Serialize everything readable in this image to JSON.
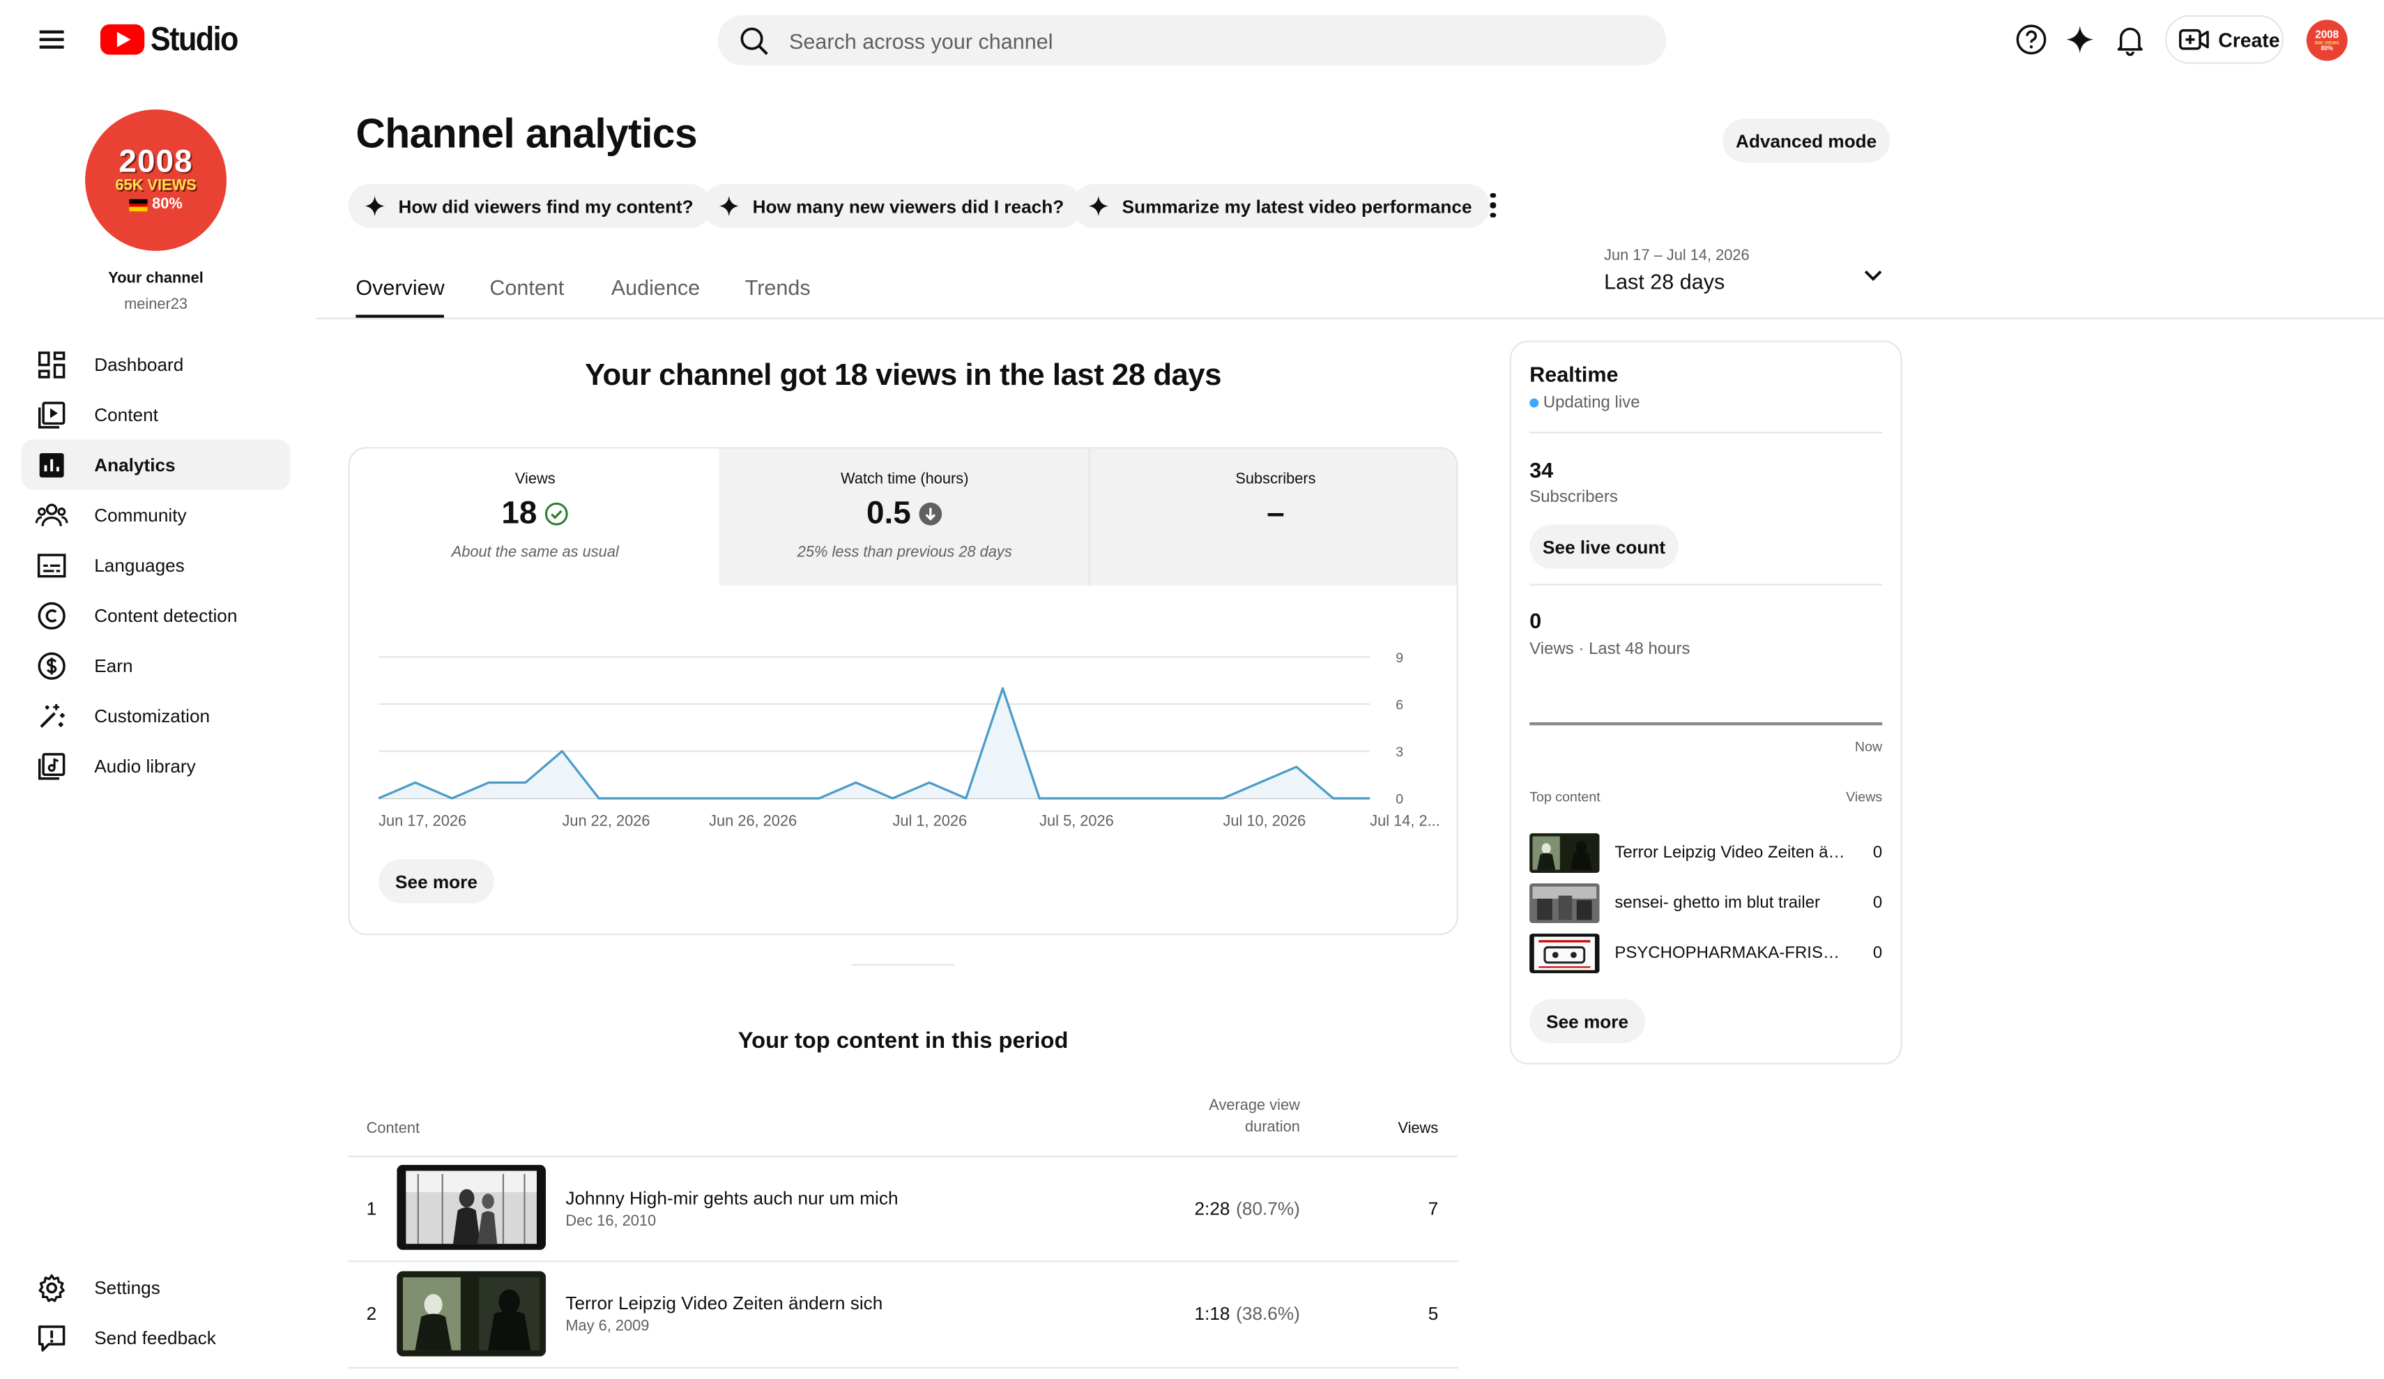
{
  "header": {
    "logo_text": "Studio",
    "search_placeholder": "Search across your channel",
    "create_label": "Create",
    "avatar_text": {
      "line1": "2008",
      "line2": "65K VIEWS",
      "line3": "80%"
    }
  },
  "sidebar": {
    "avatar": {
      "line1": "2008",
      "line2": "65K VIEWS",
      "line3": "80%"
    },
    "channel_label": "Your channel",
    "handle": "meiner23",
    "items": [
      {
        "label": "Dashboard",
        "icon": "dashboard-icon"
      },
      {
        "label": "Content",
        "icon": "content-icon"
      },
      {
        "label": "Analytics",
        "icon": "analytics-icon",
        "active": true
      },
      {
        "label": "Community",
        "icon": "community-icon"
      },
      {
        "label": "Languages",
        "icon": "languages-icon"
      },
      {
        "label": "Content detection",
        "icon": "copyright-icon"
      },
      {
        "label": "Earn",
        "icon": "dollar-icon"
      },
      {
        "label": "Customization",
        "icon": "magic-wand-icon"
      },
      {
        "label": "Audio library",
        "icon": "audio-library-icon"
      }
    ],
    "bottom_items": [
      {
        "label": "Settings",
        "icon": "gear-icon"
      },
      {
        "label": "Send feedback",
        "icon": "feedback-icon"
      }
    ]
  },
  "main": {
    "title": "Channel analytics",
    "advanced_mode": "Advanced mode",
    "chips": [
      "How did viewers find my content?",
      "How many new viewers did I reach?",
      "Summarize my latest video performance"
    ],
    "tabs": [
      "Overview",
      "Content",
      "Audience",
      "Trends"
    ],
    "date_range": {
      "dates": "Jun 17 – Jul 14, 2026",
      "label": "Last 28 days"
    },
    "headline": "Your channel got 18 views in the last 28 days",
    "metrics": [
      {
        "label": "Views",
        "value": "18",
        "note": "About the same as usual",
        "status": "check"
      },
      {
        "label": "Watch time (hours)",
        "value": "0.5",
        "note": "25% less than previous 28 days",
        "status": "down"
      },
      {
        "label": "Subscribers",
        "value": "–",
        "note": ""
      }
    ],
    "see_more": "See more",
    "top_content": {
      "title": "Your top content in this period",
      "col_content": "Content",
      "col_avd_1": "Average view",
      "col_avd_2": "duration",
      "col_views": "Views",
      "rows": [
        {
          "rank": "1",
          "title": "Johnny High-mir gehts auch nur um mich",
          "date": "Dec 16, 2010",
          "avd": "2:28",
          "pct": "(80.7%)",
          "views": "7"
        },
        {
          "rank": "2",
          "title": "Terror Leipzig Video Zeiten ändern sich",
          "date": "May 6, 2009",
          "avd": "1:18",
          "pct": "(38.6%)",
          "views": "5"
        }
      ]
    }
  },
  "chart_data": {
    "type": "area",
    "x": [
      "Jun 17",
      "Jun 18",
      "Jun 19",
      "Jun 20",
      "Jun 21",
      "Jun 22",
      "Jun 23",
      "Jun 24",
      "Jun 25",
      "Jun 26",
      "Jun 27",
      "Jun 28",
      "Jun 29",
      "Jun 30",
      "Jul 1",
      "Jul 2",
      "Jul 3",
      "Jul 4",
      "Jul 5",
      "Jul 6",
      "Jul 7",
      "Jul 8",
      "Jul 9",
      "Jul 10",
      "Jul 11",
      "Jul 12",
      "Jul 13",
      "Jul 14"
    ],
    "series": [
      {
        "values": [
          0,
          1,
          0,
          1,
          1,
          3,
          0,
          0,
          0,
          0,
          0,
          0,
          0,
          1,
          0,
          1,
          0,
          7,
          0,
          0,
          0,
          0,
          0,
          0,
          1,
          2,
          0,
          0
        ]
      }
    ],
    "x_tick_labels": [
      "Jun 17, 2026",
      "Jun 22, 2026",
      "Jun 26, 2026",
      "Jul 1, 2026",
      "Jul 5, 2026",
      "Jul 10, 2026",
      "Jul 14, 2..."
    ],
    "x_tick_index": [
      0,
      5,
      9,
      14,
      18,
      23,
      27
    ],
    "y_ticks": [
      0,
      3,
      6,
      9
    ],
    "ylim": [
      0,
      9
    ],
    "grid": true,
    "color": "#4a9cc7",
    "fill_color": "#eef5fa"
  },
  "realtime": {
    "title": "Realtime",
    "status": "Updating live",
    "subscribers_value": "34",
    "subscribers_label": "Subscribers",
    "see_live_count": "See live count",
    "views_value": "0",
    "views_label": "Views · Last 48 hours",
    "now_label": "Now",
    "top_content_label": "Top content",
    "views_col": "Views",
    "items": [
      {
        "title": "Terror Leipzig Video Zeiten ändern sich",
        "views": "0"
      },
      {
        "title": "sensei- ghetto im blut trailer",
        "views": "0"
      },
      {
        "title": "PSYCHOPHARMAKA-FRISCHE TRACKS",
        "views": "0"
      }
    ],
    "see_more": "See more"
  },
  "colors": {
    "brand": "#ff0000",
    "avatar": "#e94235",
    "chart_line": "#4a9cc7",
    "live_dot": "#3ea6ff",
    "check": "#2e7d32"
  }
}
